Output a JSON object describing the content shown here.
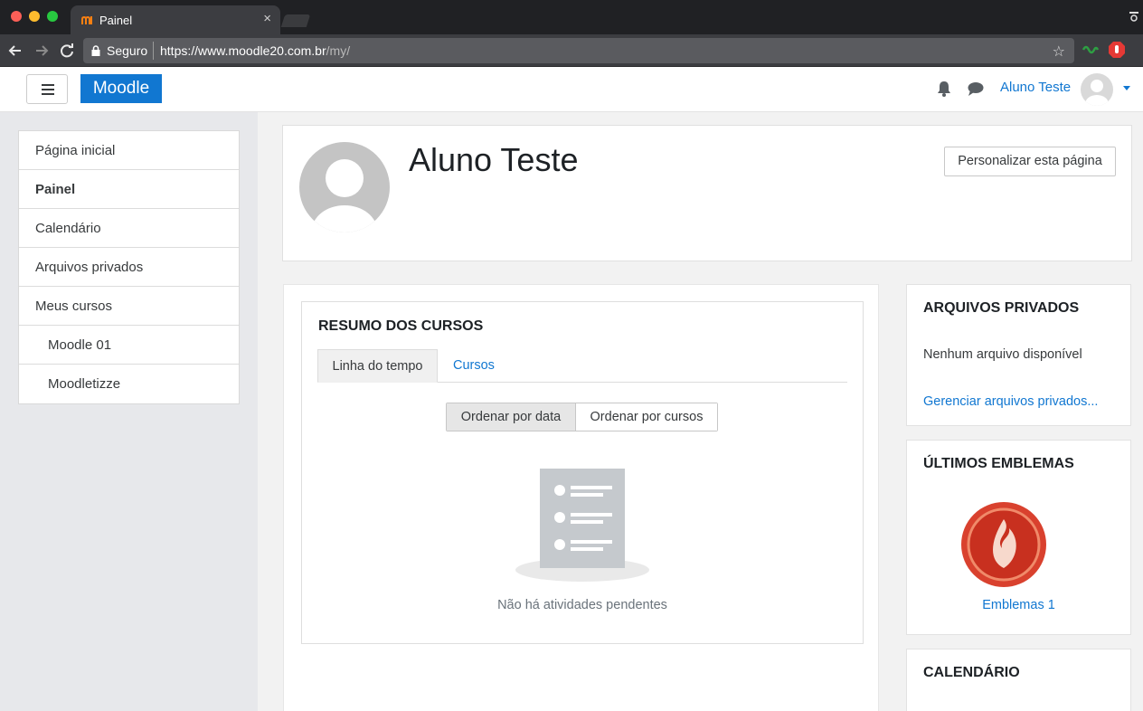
{
  "browser": {
    "tab_title": "Painel",
    "tab_close": "×",
    "secure_label": "Seguro",
    "url_main": "https://www.moodle20.com.br",
    "url_path": "/my/"
  },
  "navbar": {
    "brand": "Moodle",
    "user_name": "Aluno Teste"
  },
  "drawer": {
    "items": [
      {
        "label": "Página inicial"
      },
      {
        "label": "Painel"
      },
      {
        "label": "Calendário"
      },
      {
        "label": "Arquivos privados"
      },
      {
        "label": "Meus cursos"
      },
      {
        "label": "Moodle 01"
      },
      {
        "label": "Moodletizze"
      }
    ]
  },
  "header": {
    "title": "Aluno Teste",
    "customize_label": "Personalizar esta página"
  },
  "course_overview": {
    "title": "RESUMO DOS CURSOS",
    "tabs": [
      {
        "label": "Linha do tempo"
      },
      {
        "label": "Cursos"
      }
    ],
    "sort": [
      {
        "label": "Ordenar por data"
      },
      {
        "label": "Ordenar por cursos"
      }
    ],
    "empty_text": "Não há atividades pendentes"
  },
  "private_files": {
    "title": "ARQUIVOS PRIVADOS",
    "text": "Nenhum arquivo disponível",
    "link": "Gerenciar arquivos privados..."
  },
  "badges": {
    "title": "ÚLTIMOS EMBLEMAS",
    "badge_name": "Emblemas 1"
  },
  "calendar": {
    "title": "CALENDÁRIO"
  },
  "colors": {
    "brand": "#1177d1",
    "badge_red": "#d9412e"
  }
}
